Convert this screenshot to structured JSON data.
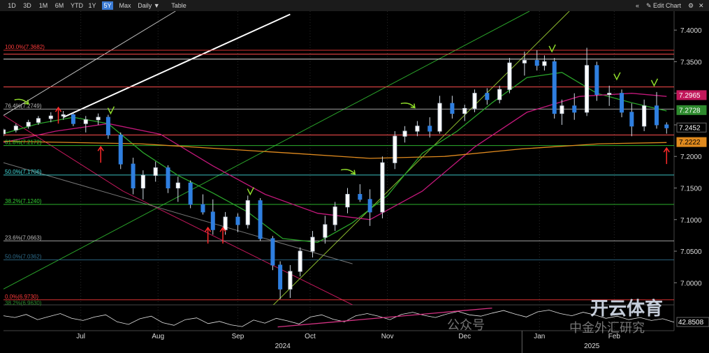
{
  "toolbar": {
    "ranges": [
      "1D",
      "3D",
      "1M",
      "6M",
      "YTD",
      "1Y",
      "5Y",
      "Max"
    ],
    "active_range": "5Y",
    "interval": "Daily ▼",
    "table_label": "Table",
    "collapse": "«",
    "edit_chart": "✎ Edit Chart",
    "settings": "⚙",
    "close": "✕"
  },
  "watermark": {
    "wechat": "公众号",
    "brand": "开云体育",
    "brand_sub": "中金外汇研究"
  },
  "chart_data": {
    "type": "candlestick",
    "ylim": [
      6.965,
      7.43
    ],
    "xlim": [
      "2024-06-07",
      "2025-03-03"
    ],
    "y_ticks": [
      7.4,
      7.35,
      7.3,
      7.25,
      7.2,
      7.15,
      7.1,
      7.05,
      7.0
    ],
    "y_tick_labels": [
      "7.4000",
      "7.3500",
      "7.3000",
      "7.2500",
      "7.2000",
      "7.1500",
      "7.1000",
      "7.0500",
      "7.0000"
    ],
    "x_ticks": [
      {
        "date": "2024-07-08",
        "label": "Jul"
      },
      {
        "date": "2024-08-08",
        "label": "Aug"
      },
      {
        "date": "2024-09-09",
        "label": "Sep"
      },
      {
        "date": "2024-10-08",
        "label": "Oct"
      },
      {
        "date": "2024-11-08",
        "label": "Nov"
      },
      {
        "date": "2024-12-09",
        "label": "Dec"
      },
      {
        "date": "2025-01-08",
        "label": "Jan"
      },
      {
        "date": "2025-02-07",
        "label": "Feb"
      }
    ],
    "year_labels": [
      {
        "date": "2024-09-27",
        "label": "2024"
      },
      {
        "date": "2025-01-29",
        "label": "2025"
      }
    ],
    "price_tags": [
      {
        "value": 7.2965,
        "label": "7.2965",
        "bg": "#c2185b",
        "fg": "#ffffff"
      },
      {
        "value": 7.2728,
        "label": "7.2728",
        "bg": "#2e8b2e",
        "fg": "#ffffff"
      },
      {
        "value": 7.2452,
        "label": "7.2452",
        "bg": "#000000",
        "fg": "#ffffff"
      },
      {
        "value": 7.2222,
        "label": "7.2222",
        "bg": "#e08a1e",
        "fg": "#000000"
      }
    ],
    "fib_levels": [
      {
        "value": 7.3682,
        "label": "100.0%(7.3682)",
        "color": "#ff3b3b"
      },
      {
        "value": 7.2749,
        "label": "76.4%(7.2749)",
        "color": "#bbbbbb"
      },
      {
        "value": 7.2172,
        "label": "61.8%(7.2172)",
        "color": "#34d134"
      },
      {
        "value": 7.1706,
        "label": "50.0%(7.1706)",
        "color": "#45e0e0"
      },
      {
        "value": 7.124,
        "label": "38.2%(7.1240)",
        "color": "#34d134"
      },
      {
        "value": 7.0663,
        "label": "23.6%(7.0663)",
        "color": "#bbbbbb"
      },
      {
        "value": 7.0362,
        "label": "50.0%(7.0362)",
        "color": "#2f6f8f"
      },
      {
        "value": 6.973,
        "label": "0.0%(6.9730)",
        "color": "#ff3b3b"
      },
      {
        "value": 6.963,
        "label": "38.2%(6.9630)",
        "color": "#2e8b2e"
      }
    ],
    "horizontal_lines": [
      {
        "value": 7.362,
        "color": "#ff4d4d"
      },
      {
        "value": 7.354,
        "color": "#dddddd"
      },
      {
        "value": 7.31,
        "color": "#ff4d4d"
      },
      {
        "value": 7.234,
        "color": "#ff4d4d"
      }
    ],
    "series": [
      {
        "name": "fast MA",
        "color": "#2aa32a",
        "points": [
          [
            "2024-06-07",
            7.236
          ],
          [
            "2024-06-21",
            7.252
          ],
          [
            "2024-07-05",
            7.262
          ],
          [
            "2024-07-19",
            7.252
          ],
          [
            "2024-08-02",
            7.206
          ],
          [
            "2024-08-16",
            7.17
          ],
          [
            "2024-08-30",
            7.142
          ],
          [
            "2024-09-13",
            7.112
          ],
          [
            "2024-09-27",
            7.07
          ],
          [
            "2024-10-11",
            7.064
          ],
          [
            "2024-10-25",
            7.095
          ],
          [
            "2024-11-08",
            7.138
          ],
          [
            "2024-11-22",
            7.205
          ],
          [
            "2024-12-06",
            7.24
          ],
          [
            "2024-12-20",
            7.285
          ],
          [
            "2025-01-03",
            7.325
          ],
          [
            "2025-01-17",
            7.333
          ],
          [
            "2025-01-31",
            7.3
          ],
          [
            "2025-02-14",
            7.285
          ],
          [
            "2025-02-28",
            7.272
          ]
        ]
      },
      {
        "name": "slow MA",
        "color": "#c2187a",
        "points": [
          [
            "2024-06-07",
            7.222
          ],
          [
            "2024-06-28",
            7.24
          ],
          [
            "2024-07-19",
            7.252
          ],
          [
            "2024-08-09",
            7.235
          ],
          [
            "2024-08-30",
            7.185
          ],
          [
            "2024-09-20",
            7.14
          ],
          [
            "2024-10-11",
            7.11
          ],
          [
            "2024-11-01",
            7.1
          ],
          [
            "2024-11-22",
            7.145
          ],
          [
            "2024-12-13",
            7.215
          ],
          [
            "2025-01-03",
            7.27
          ],
          [
            "2025-01-24",
            7.295
          ],
          [
            "2025-02-14",
            7.3
          ],
          [
            "2025-02-28",
            7.295
          ]
        ]
      },
      {
        "name": "long MA",
        "color": "#e08a1e",
        "points": [
          [
            "2024-06-07",
            7.224
          ],
          [
            "2024-08-01",
            7.22
          ],
          [
            "2024-10-01",
            7.205
          ],
          [
            "2024-11-01",
            7.197
          ],
          [
            "2024-12-01",
            7.2
          ],
          [
            "2025-01-01",
            7.212
          ],
          [
            "2025-02-01",
            7.22
          ],
          [
            "2025-02-28",
            7.222
          ]
        ]
      }
    ],
    "trendlines": [
      {
        "from": [
          "2024-06-07",
          7.265
        ],
        "to": [
          "2024-07-25",
          7.145
        ],
        "color": "#c2185b"
      },
      {
        "from": [
          "2024-07-25",
          7.145
        ],
        "to": [
          "2024-10-25",
          6.965
        ],
        "color": "#c2185b"
      },
      {
        "from": [
          "2024-06-07",
          6.99
        ],
        "to": [
          "2025-01-04",
          7.43
        ],
        "color": "#2aa32a"
      },
      {
        "from": [
          "2024-09-22",
          6.96
        ],
        "to": [
          "2025-01-20",
          7.43
        ],
        "color": "#8fbf2f"
      },
      {
        "from": [
          "2024-06-07",
          7.265
        ],
        "to": [
          "2024-08-15",
          7.43
        ],
        "color": "#bbbbbb"
      },
      {
        "from": [
          "2024-06-07",
          7.19
        ],
        "to": [
          "2024-10-25",
          7.03
        ],
        "color": "#777777"
      },
      {
        "from": [
          "2024-07-01",
          7.262
        ],
        "to": [
          "2024-09-30",
          7.425
        ],
        "color": "#ffffff"
      }
    ],
    "candles": [
      [
        "2024-06-07",
        7.236,
        7.244,
        7.232,
        7.242
      ],
      [
        "2024-06-12",
        7.242,
        7.252,
        7.238,
        7.248
      ],
      [
        "2024-06-17",
        7.248,
        7.258,
        7.244,
        7.254
      ],
      [
        "2024-06-21",
        7.254,
        7.264,
        7.25,
        7.26
      ],
      [
        "2024-06-26",
        7.26,
        7.27,
        7.254,
        7.264
      ],
      [
        "2024-07-01",
        7.264,
        7.272,
        7.258,
        7.266
      ],
      [
        "2024-07-05",
        7.266,
        7.27,
        7.248,
        7.252
      ],
      [
        "2024-07-10",
        7.252,
        7.264,
        7.238,
        7.258
      ],
      [
        "2024-07-15",
        7.258,
        7.268,
        7.25,
        7.262
      ],
      [
        "2024-07-19",
        7.262,
        7.266,
        7.228,
        7.234
      ],
      [
        "2024-07-24",
        7.234,
        7.238,
        7.18,
        7.188
      ],
      [
        "2024-07-29",
        7.188,
        7.198,
        7.14,
        7.15
      ],
      [
        "2024-08-02",
        7.15,
        7.178,
        7.132,
        7.17
      ],
      [
        "2024-08-07",
        7.17,
        7.192,
        7.16,
        7.182
      ],
      [
        "2024-08-12",
        7.182,
        7.186,
        7.142,
        7.15
      ],
      [
        "2024-08-16",
        7.15,
        7.168,
        7.128,
        7.158
      ],
      [
        "2024-08-21",
        7.158,
        7.162,
        7.118,
        7.124
      ],
      [
        "2024-08-26",
        7.124,
        7.14,
        7.108,
        7.112
      ],
      [
        "2024-08-30",
        7.112,
        7.132,
        7.076,
        7.084
      ],
      [
        "2024-09-04",
        7.084,
        7.112,
        7.076,
        7.104
      ],
      [
        "2024-09-09",
        7.104,
        7.11,
        7.08,
        7.092
      ],
      [
        "2024-09-13",
        7.092,
        7.138,
        7.086,
        7.13
      ],
      [
        "2024-09-18",
        7.13,
        7.134,
        7.066,
        7.07
      ],
      [
        "2024-09-23",
        7.07,
        7.074,
        7.02,
        7.028
      ],
      [
        "2024-09-26",
        7.028,
        7.034,
        6.974,
        6.99
      ],
      [
        "2024-09-30",
        6.99,
        7.028,
        6.976,
        7.018
      ],
      [
        "2024-10-04",
        7.018,
        7.056,
        7.01,
        7.05
      ],
      [
        "2024-10-09",
        7.05,
        7.082,
        7.04,
        7.072
      ],
      [
        "2024-10-14",
        7.072,
        7.106,
        7.062,
        7.092
      ],
      [
        "2024-10-18",
        7.092,
        7.128,
        7.082,
        7.12
      ],
      [
        "2024-10-23",
        7.12,
        7.15,
        7.11,
        7.14
      ],
      [
        "2024-10-28",
        7.14,
        7.156,
        7.128,
        7.132
      ],
      [
        "2024-11-01",
        7.132,
        7.148,
        7.09,
        7.112
      ],
      [
        "2024-11-06",
        7.112,
        7.2,
        7.102,
        7.19
      ],
      [
        "2024-11-11",
        7.19,
        7.24,
        7.18,
        7.232
      ],
      [
        "2024-11-15",
        7.232,
        7.248,
        7.222,
        7.24
      ],
      [
        "2024-11-20",
        7.24,
        7.256,
        7.232,
        7.248
      ],
      [
        "2024-11-25",
        7.248,
        7.262,
        7.23,
        7.24
      ],
      [
        "2024-11-29",
        7.24,
        7.296,
        7.236,
        7.284
      ],
      [
        "2024-12-04",
        7.284,
        7.296,
        7.26,
        7.268
      ],
      [
        "2024-12-09",
        7.268,
        7.282,
        7.256,
        7.276
      ],
      [
        "2024-12-13",
        7.276,
        7.306,
        7.27,
        7.3
      ],
      [
        "2024-12-18",
        7.3,
        7.308,
        7.282,
        7.29
      ],
      [
        "2024-12-23",
        7.29,
        7.312,
        7.284,
        7.306
      ],
      [
        "2024-12-27",
        7.306,
        7.356,
        7.3,
        7.348
      ],
      [
        "2025-01-02",
        7.348,
        7.366,
        7.328,
        7.352
      ],
      [
        "2025-01-07",
        7.352,
        7.368,
        7.336,
        7.344
      ],
      [
        "2025-01-10",
        7.344,
        7.36,
        7.336,
        7.35
      ],
      [
        "2025-01-14",
        7.35,
        7.356,
        7.26,
        7.268
      ],
      [
        "2025-01-17",
        7.268,
        7.29,
        7.25,
        7.28
      ],
      [
        "2025-01-22",
        7.28,
        7.3,
        7.258,
        7.27
      ],
      [
        "2025-01-27",
        7.27,
        7.372,
        7.264,
        7.344
      ],
      [
        "2025-01-31",
        7.344,
        7.35,
        7.288,
        7.298
      ],
      [
        "2025-02-05",
        7.298,
        7.312,
        7.28,
        7.3
      ],
      [
        "2025-02-10",
        7.3,
        7.306,
        7.262,
        7.27
      ],
      [
        "2025-02-14",
        7.27,
        7.284,
        7.232,
        7.248
      ],
      [
        "2025-02-19",
        7.248,
        7.29,
        7.24,
        7.28
      ],
      [
        "2025-02-24",
        7.28,
        7.302,
        7.244,
        7.25
      ],
      [
        "2025-02-28",
        7.25,
        7.254,
        7.236,
        7.2452
      ]
    ],
    "signals": [
      {
        "date": "2024-06-17",
        "value": 7.283,
        "kind": "green-arrow"
      },
      {
        "date": "2024-07-20",
        "value": 7.268,
        "kind": "green-check"
      },
      {
        "date": "2024-09-14",
        "value": 7.14,
        "kind": "green-check"
      },
      {
        "date": "2024-10-26",
        "value": 7.172,
        "kind": "green-arrow"
      },
      {
        "date": "2024-11-19",
        "value": 7.277,
        "kind": "green-arrow"
      },
      {
        "date": "2025-01-13",
        "value": 7.366,
        "kind": "green-check"
      },
      {
        "date": "2025-02-08",
        "value": 7.322,
        "kind": "green-check"
      },
      {
        "date": "2025-02-23",
        "value": 7.312,
        "kind": "green-check"
      },
      {
        "date": "2024-06-29",
        "value": 7.252,
        "kind": "red-up"
      },
      {
        "date": "2024-07-16",
        "value": 7.19,
        "kind": "red-up"
      },
      {
        "date": "2024-08-28",
        "value": 7.062,
        "kind": "red-up"
      },
      {
        "date": "2024-09-03",
        "value": 7.062,
        "kind": "red-up"
      },
      {
        "date": "2025-02-28",
        "value": 7.188,
        "kind": "red-up"
      }
    ],
    "oscillator": {
      "label": "42.8508",
      "values": [
        58,
        54,
        61,
        49,
        56,
        63,
        52,
        47,
        55,
        60,
        44,
        38,
        51,
        57,
        42,
        36,
        49,
        53,
        40,
        45,
        37,
        33,
        48,
        41,
        52,
        46,
        39,
        55,
        60,
        50,
        44,
        58,
        63,
        57,
        49,
        61,
        66,
        59,
        54,
        62,
        68,
        60,
        57,
        64,
        70,
        62,
        55,
        67,
        71,
        63,
        58,
        66,
        60,
        52,
        57,
        49,
        54,
        47,
        51,
        43
      ],
      "trend": {
        "from": [
          "2024-09-25",
          0.15
        ],
        "to": [
          "2024-12-20",
          0.9
        ],
        "color": "#d63384"
      }
    }
  }
}
